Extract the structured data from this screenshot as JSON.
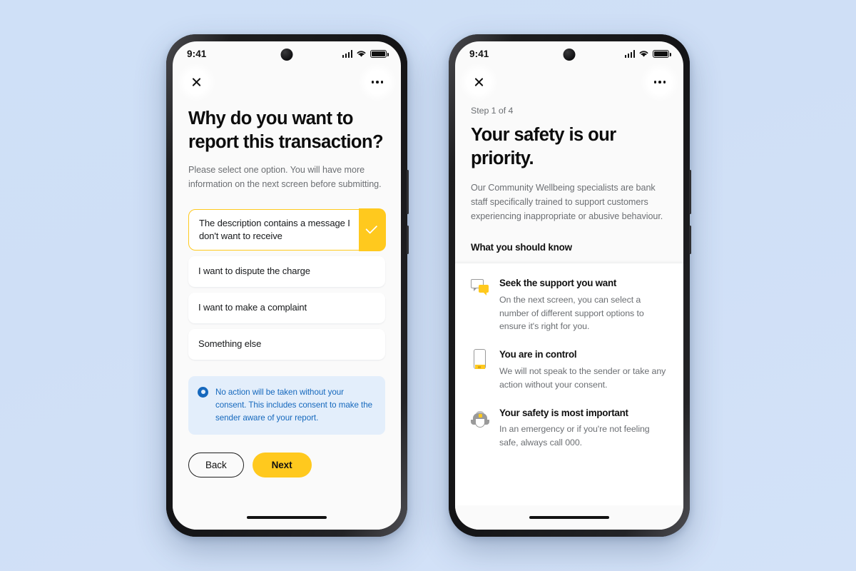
{
  "theme": {
    "background": "#cfe0f7",
    "accent_yellow": "#FFC91E",
    "info_blue": "#1568bd",
    "info_blue_bg": "#e3eefb",
    "screen_bg": "#fafafa"
  },
  "phone_left": {
    "status_bar": {
      "time": "9:41",
      "signal_icon": "cellular-signal-icon",
      "wifi_icon": "wifi-icon",
      "battery_icon": "battery-full-icon"
    },
    "nav": {
      "close_label": "close-icon",
      "menu_label": "more-options-icon"
    },
    "title": "Why do you want to report this transaction?",
    "lede": "Please select one option. You will have more information on the next screen before submitting.",
    "options": [
      {
        "label": "The description contains a message I don't want to receive",
        "selected": true
      },
      {
        "label": "I want to dispute the charge",
        "selected": false
      },
      {
        "label": "I want to make a complaint",
        "selected": false
      },
      {
        "label": "Something else",
        "selected": false
      }
    ],
    "info_notice": "No action will be taken without your consent. This includes consent to make the sender aware of your report.",
    "buttons": {
      "back": "Back",
      "next": "Next"
    }
  },
  "phone_right": {
    "status_bar": {
      "time": "9:41",
      "signal_icon": "cellular-signal-icon",
      "wifi_icon": "wifi-icon",
      "battery_icon": "battery-full-icon"
    },
    "nav": {
      "close_label": "close-icon",
      "menu_label": "more-options-icon"
    },
    "step": "Step 1 of 4",
    "title": "Your safety is our priority.",
    "lede": "Our Community Wellbeing specialists are bank staff specifically trained to support customers experiencing inappropriate or abusive behaviour.",
    "subhead": "What you should know",
    "features": [
      {
        "icon": "chat-bubbles-icon",
        "heading": "Seek the support you want",
        "body": "On the next screen, you can select a number of different support options to ensure it's right for you."
      },
      {
        "icon": "mobile-phone-icon",
        "heading": "You are in control",
        "body": "We will not speak to the sender or take any action without your consent."
      },
      {
        "icon": "police-cap-icon",
        "heading": "Your safety is most important",
        "body": "In an emergency or if you're not feeling safe, always call 000."
      }
    ]
  }
}
